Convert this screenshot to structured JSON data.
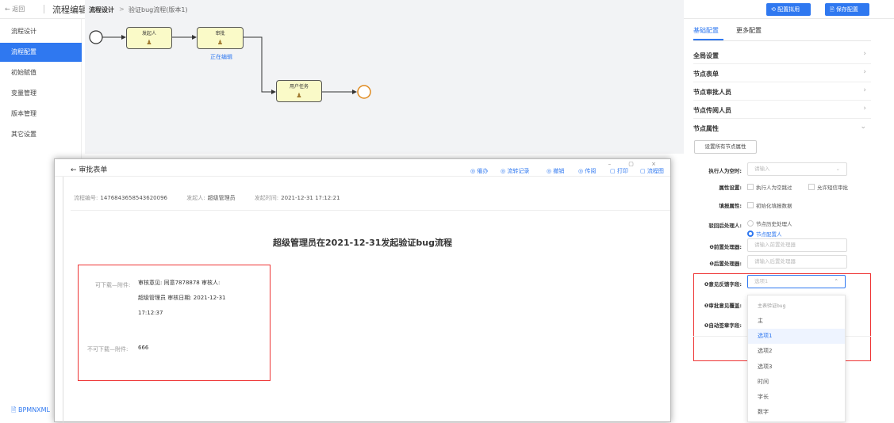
{
  "topbar": {
    "back_label": "← 返回",
    "app_title": "流程编辑",
    "breadcrumb_current": "流程设计",
    "breadcrumb_sep": ">",
    "breadcrumb_item": "验证bug流程(版本1)",
    "enable_button": "⟲ 配置拟用",
    "save_button": "🗎 保存配置"
  },
  "sidebar": {
    "items": [
      {
        "label": "流程设计"
      },
      {
        "label": "流程配置"
      },
      {
        "label": "初始赋值"
      },
      {
        "label": "变量管理"
      },
      {
        "label": "版本管理"
      },
      {
        "label": "其它设置"
      }
    ],
    "active_index": 1,
    "bpmn_link": "🗎 BPMNXML"
  },
  "canvas": {
    "tasks": [
      "发起人",
      "审批",
      "用户任务"
    ],
    "editing_label": "正在编辑"
  },
  "right_panel": {
    "tabs": [
      "基础配置",
      "更多配置"
    ],
    "sections": [
      "全局设置",
      "节点表单",
      "节点审批人员",
      "节点传阅人员",
      "节点属性"
    ],
    "set_all_button": "设置所有节点属性",
    "rows": {
      "executor_empty_label": "执行人为空时:",
      "executor_empty_placeholder": "请输入",
      "prop_settings_label": "属性设置:",
      "prop_opt1": "执行人为空跳过",
      "prop_opt2": "允许短信审批",
      "fill_prop_label": "填报属性:",
      "fill_prop_opt": "初始化填报数据",
      "reject_handler_label": "驳回后处理人:",
      "reject_opt1": "节点历史处理人",
      "reject_opt2": "节点配置人",
      "pre_handler_label": "❶前置处理器:",
      "pre_handler_placeholder": "请输入前置处理器",
      "post_handler_label": "❶后置处理器:",
      "post_handler_placeholder": "请输入后置处理器",
      "opinion_field_label": "❶意见反馈字段:",
      "opinion_field_value": "选项1",
      "opinion_override_label": "❶审批意见覆盖:",
      "auto_sign_label": "❶自动签章字段:"
    },
    "dropdown_options": [
      "主表验证bug",
      "主",
      "选项1",
      "选项2",
      "选项3",
      "时间",
      "字长",
      "数字"
    ],
    "dropdown_selected": 2
  },
  "overlay": {
    "title": "← 审批表单",
    "tools": [
      "◎ 催办",
      "◎ 流转记录",
      "◎ 撤销",
      "◎ 传阅",
      "▢ 打印",
      "▢ 流程图"
    ],
    "win_controls": "– ▢ ×",
    "meta": {
      "no_label": "流程编号:",
      "no_value": "1476843658543620096",
      "initiator_label": "发起人:",
      "initiator_value": "超级管理员",
      "time_label": "发起时间:",
      "time_value": "2021-12-31 17:12:21"
    },
    "doc_title": "超级管理员在2021-12-31发起验证bug流程",
    "attach1_label": "可下载—附件:",
    "attach1_line1": "审核意见: 同意7878878 审核人:",
    "attach1_line2": "超级管理员 审核日期: 2021-12-31",
    "attach1_line3": "17:12:37",
    "attach2_label": "不可下载—附件:",
    "attach2_value": "666"
  },
  "colors": {
    "accent": "#2f78f0",
    "highlight_box": "#ee3333"
  }
}
